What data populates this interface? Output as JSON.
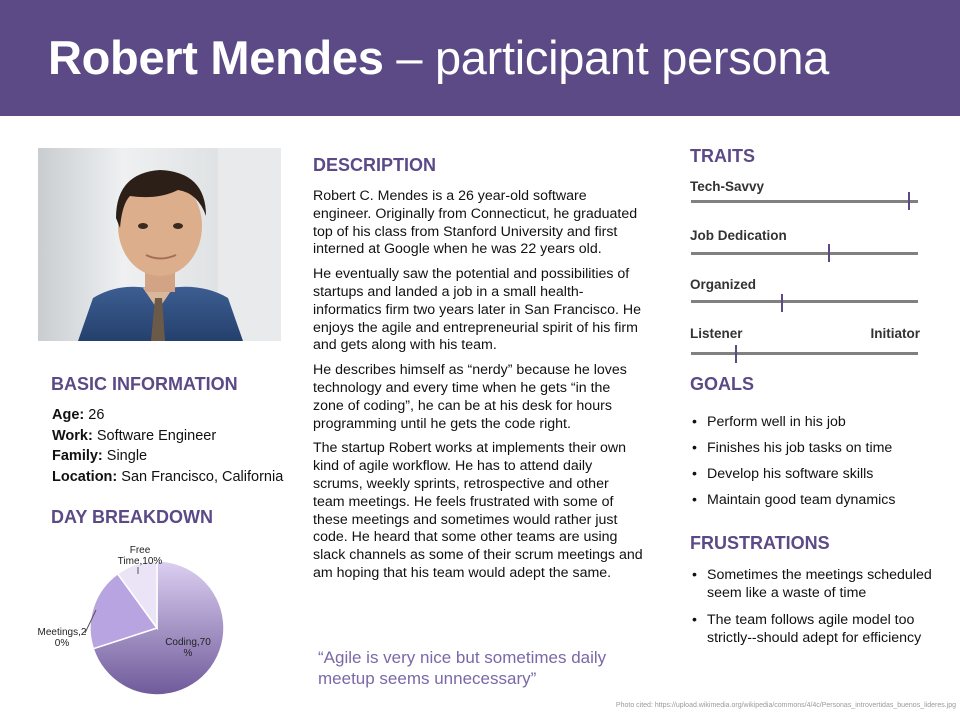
{
  "header": {
    "name": "Robert Mendes",
    "rest": " – participant persona"
  },
  "sections": {
    "basic": "BASIC INFORMATION",
    "day": "DAY BREAKDOWN",
    "description": "DESCRIPTION",
    "traits": "TRAITS",
    "goals": "GOALS",
    "frustrations": "FRUSTRATIONS"
  },
  "basic_info": [
    {
      "label": "Age:",
      "value": " 26"
    },
    {
      "label": "Work:",
      "value": " Software Engineer"
    },
    {
      "label": "Family:",
      "value": " Single"
    },
    {
      "label": "Location:",
      "value": " San Francisco, California"
    }
  ],
  "description": [
    "Robert C. Mendes is a 26 year-old software engineer. Originally from Connecticut, he graduated top of his class from Stanford University and first interned at Google when he was 22 years old.",
    "He eventually saw the potential and possibilities of startups and landed a job in a small health-informatics firm two years later in San Francisco. He enjoys the agile and entrepreneurial spirit of his firm and gets along with his team.",
    "He describes himself as “nerdy” because he loves technology and every time when he gets “in the zone of coding”, he can be at his desk for hours programming until he gets the code right.",
    "The startup Robert works at implements their own kind of agile workflow. He has to attend daily scrums, weekly sprints, retrospective and other team meetings. He feels frustrated with some of these meetings and sometimes would rather just code. He heard that some other teams are using slack channels as some of their scrum meetings and am hoping that his team would adept the same."
  ],
  "quote": "“Agile is very nice but sometimes daily meetup seems unnecessary”",
  "traits": [
    {
      "label": "Tech-Savvy",
      "level": 0.96
    },
    {
      "label": "Job Dedication",
      "level": 0.61
    },
    {
      "label": "Organized",
      "level": 0.4
    },
    {
      "label": "Listener",
      "label_right": "Initiator",
      "level": 0.2
    }
  ],
  "goals": [
    "Perform well in his job",
    "Finishes his job tasks on time",
    "Develop his software skills",
    "Maintain good team dynamics"
  ],
  "frustrations": [
    "Sometimes the meetings scheduled seem like a waste of time",
    "The team follows agile model too strictly--should adept for efficiency"
  ],
  "credit": "Photo cited: https://upload.wikimedia.org/wikipedia/commons/4/4c/Personas_introvertidas_buenos_lideres.jpg",
  "colors": {
    "accent": "#5b4a86",
    "quote": "#7a68a8"
  },
  "chart_data": {
    "type": "pie",
    "labels": [
      "Coding",
      "Meetings",
      "Free Time"
    ],
    "label_texts": [
      "Coding,70\n%",
      "Meetings,2\n0%",
      "Free\nTime,10%"
    ],
    "values": [
      70,
      20,
      10
    ],
    "colors": [
      "#d4c6ee",
      "#b8a4e0",
      "#ebe4f6"
    ]
  }
}
